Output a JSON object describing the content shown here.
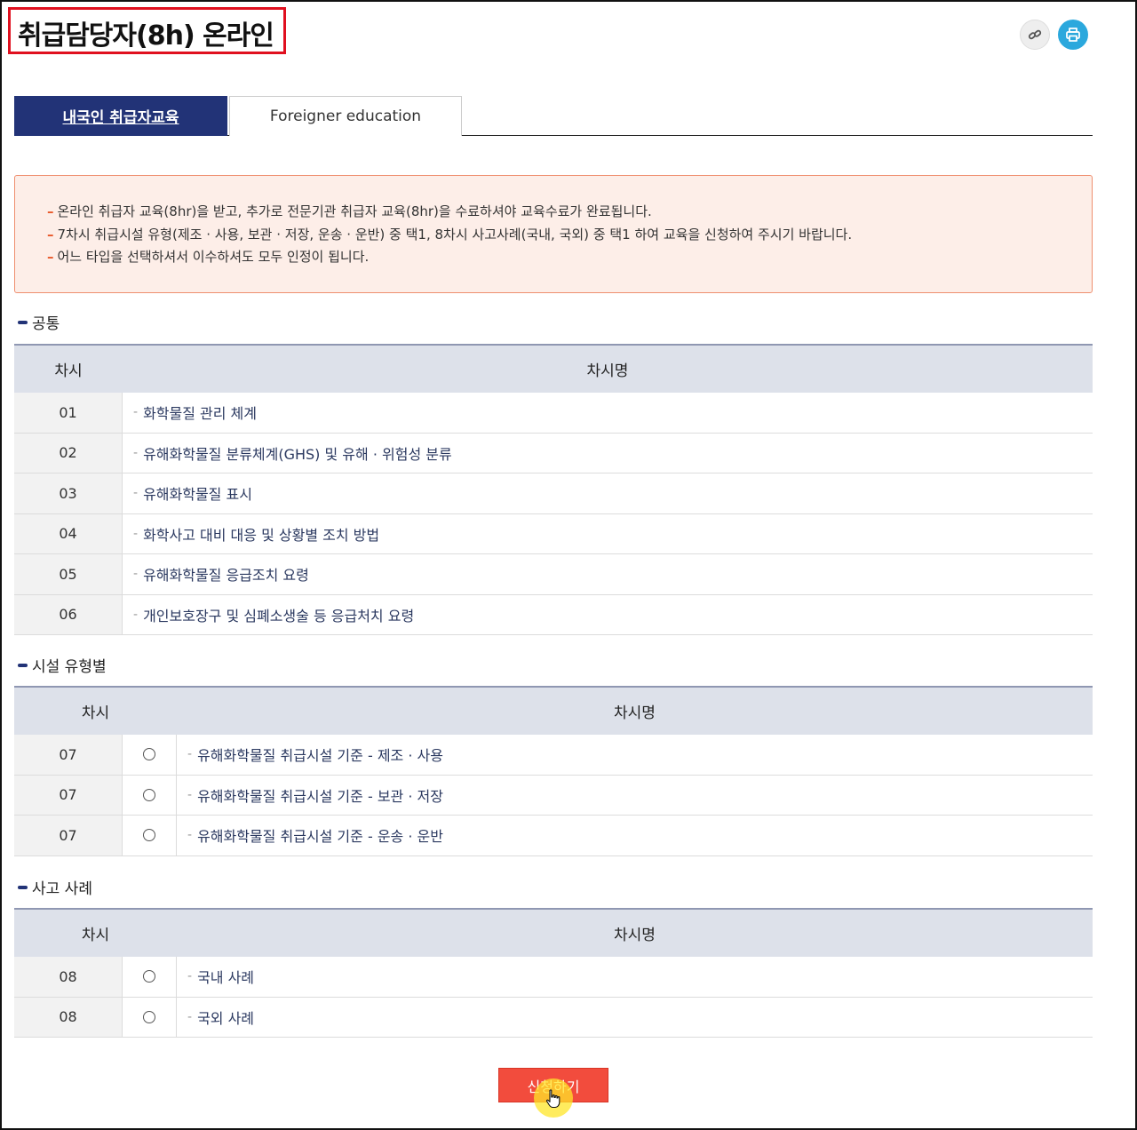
{
  "page": {
    "title": "취급담당자(8h) 온라인"
  },
  "tools": {
    "link_icon": "link-icon",
    "print_icon": "print-icon"
  },
  "tabs": [
    {
      "label": "내국인 취급자교육",
      "active": true
    },
    {
      "label": "Foreigner education",
      "active": false
    }
  ],
  "notice": {
    "lines": [
      "온라인 취급자 교육(8hr)을 받고, 추가로 전문기관 취급자 교육(8hr)을 수료하셔야 교육수료가 완료됩니다.",
      "7차시 취급시설 유형(제조 · 사용, 보관 · 저장, 운송 · 운반) 중 택1, 8차시 사고사례(국내, 국외) 중 택1 하여 교육을 신청하여 주시기 바랍니다.",
      "어느 타입을 선택하셔서 이수하셔도 모두 인정이 됩니다."
    ]
  },
  "sections": [
    {
      "title": "공통",
      "headers": [
        "차시",
        "차시명"
      ],
      "rows": [
        {
          "no": "01",
          "name": "화학물질 관리 체계"
        },
        {
          "no": "02",
          "name": "유해화학물질 분류체계(GHS) 및 유해 · 위험성 분류"
        },
        {
          "no": "03",
          "name": "유해화학물질 표시"
        },
        {
          "no": "04",
          "name": "화학사고 대비 대응 및 상황별 조치 방법"
        },
        {
          "no": "05",
          "name": "유해화학물질 응급조치 요령"
        },
        {
          "no": "06",
          "name": "개인보호장구 및 심폐소생술 등 응급처치 요령"
        }
      ]
    },
    {
      "title": "시설 유형별",
      "headers": [
        "차시",
        "차시명"
      ],
      "rows": [
        {
          "no": "07",
          "name": "유해화학물질 취급시설 기준 - 제조 · 사용",
          "selected": false
        },
        {
          "no": "07",
          "name": "유해화학물질 취급시설 기준 - 보관 · 저장",
          "selected": false
        },
        {
          "no": "07",
          "name": "유해화학물질 취급시설 기준 - 운송 · 운반",
          "selected": false
        }
      ]
    },
    {
      "title": "사고 사례",
      "headers": [
        "차시",
        "차시명"
      ],
      "rows": [
        {
          "no": "08",
          "name": "국내 사례",
          "selected": false
        },
        {
          "no": "08",
          "name": "국외 사례",
          "selected": false
        }
      ]
    }
  ],
  "apply": {
    "label": "신청하기"
  },
  "colors": {
    "tab_active": "#223377",
    "apply_button": "#f24c3d",
    "print_button": "#2ba8dd",
    "notice_border": "#ef8f6f"
  }
}
